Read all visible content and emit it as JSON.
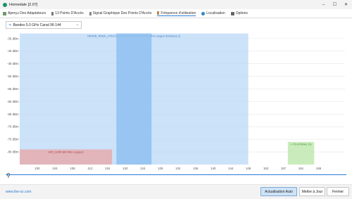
{
  "window": {
    "title": "Homedale [2.07]"
  },
  "tabs": [
    {
      "label": "Aperçu Des Adaptateurs",
      "icon": "adapter-icon"
    },
    {
      "label": "13 Points D'Accès",
      "icon": "access-points-icon"
    },
    {
      "label": "Signal Graphique Des Points D'Accès",
      "icon": "signal-graph-icon"
    },
    {
      "label": "Fréquence d'utilisation",
      "icon": "frequency-icon",
      "active": true
    },
    {
      "label": "Localisation",
      "icon": "location-icon"
    },
    {
      "label": "Options",
      "icon": "options-icon"
    }
  ],
  "band": {
    "selected": "Bandes 5.0 GHz Canal 96-144"
  },
  "chart_data": {
    "type": "area",
    "ylabel": "",
    "xlabel": "",
    "y_ticks": [
      "-35 dBm",
      "-40 dBm",
      "-45 dBm",
      "-50 dBm",
      "-55 dBm",
      "-60 dBm",
      "-65 dBm",
      "-70 dBm",
      "-75 dBm",
      "-80 dBm"
    ],
    "ylim": [
      -85,
      -32
    ],
    "x_ticks": [
      "100",
      "104",
      "108",
      "112",
      "116",
      "120",
      "124",
      "128",
      "132",
      "136",
      "140",
      "144",
      "149",
      "153",
      "157",
      "161",
      "165"
    ],
    "xlim": [
      94,
      168
    ],
    "networks": [
      {
        "label": "RAXDB_ROBIL_OTECIS_RODSTER_BOWFI (160 MHz Largeur Ambiance 1)",
        "from": 94,
        "to": 146,
        "level": -33,
        "color": "#b9d8f7"
      },
      {
        "label": "",
        "from": 116,
        "to": 124,
        "level": -33,
        "color": "#8fbff0"
      },
      {
        "label": "SFR_A39R (80 MHz Largeur)",
        "from": 94,
        "to": 115,
        "level": -79,
        "color": "#e9a6a6"
      },
      {
        "label": "+-75 HYDRA1 2G",
        "from": 155,
        "to": 161,
        "level": -76,
        "color": "#b8e6a6"
      }
    ]
  },
  "footer": {
    "link": "www.the-sz.com",
    "buttons": {
      "auto_update": "Actualisation Auto",
      "update_now": "Mettre à Jour",
      "close": "Fermer"
    }
  }
}
